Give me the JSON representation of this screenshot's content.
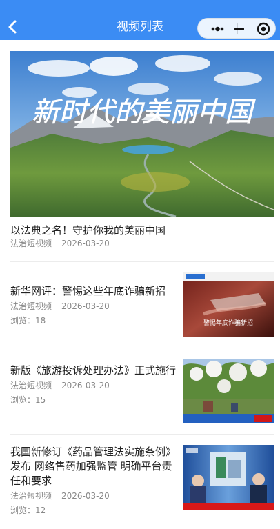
{
  "header": {
    "title": "视频列表",
    "back_icon": "chevron-left-icon",
    "capsule": {
      "more_icon": "more-dots-icon",
      "minimize_icon": "minus-icon",
      "close_icon": "target-circle-icon"
    },
    "background": "#3b8cf4"
  },
  "featured": {
    "image_text": "新时代的美丽中国",
    "title": "以法典之名！守护你我的美丽中国",
    "source": "法治短视频",
    "date": "2026-03-20"
  },
  "videos": [
    {
      "title": "新华网评：警惕这些年底诈骗新招",
      "source": "法治短视频",
      "date": "2026-03-20",
      "views_label": "浏览：18",
      "thumb_caption": "警惕年底诈骗新招"
    },
    {
      "title": "新版《旅游投诉处理办法》正式施行",
      "source": "法治短视频",
      "date": "2026-03-20",
      "views_label": "浏览：15",
      "thumb_caption": ""
    },
    {
      "title": "我国新修订《药品管理法实施条例》发布 网络售药加强监管 明确平台责任和要求",
      "source": "法治短视频",
      "date": "2026-03-20",
      "views_label": "浏览：12",
      "thumb_caption": ""
    }
  ]
}
